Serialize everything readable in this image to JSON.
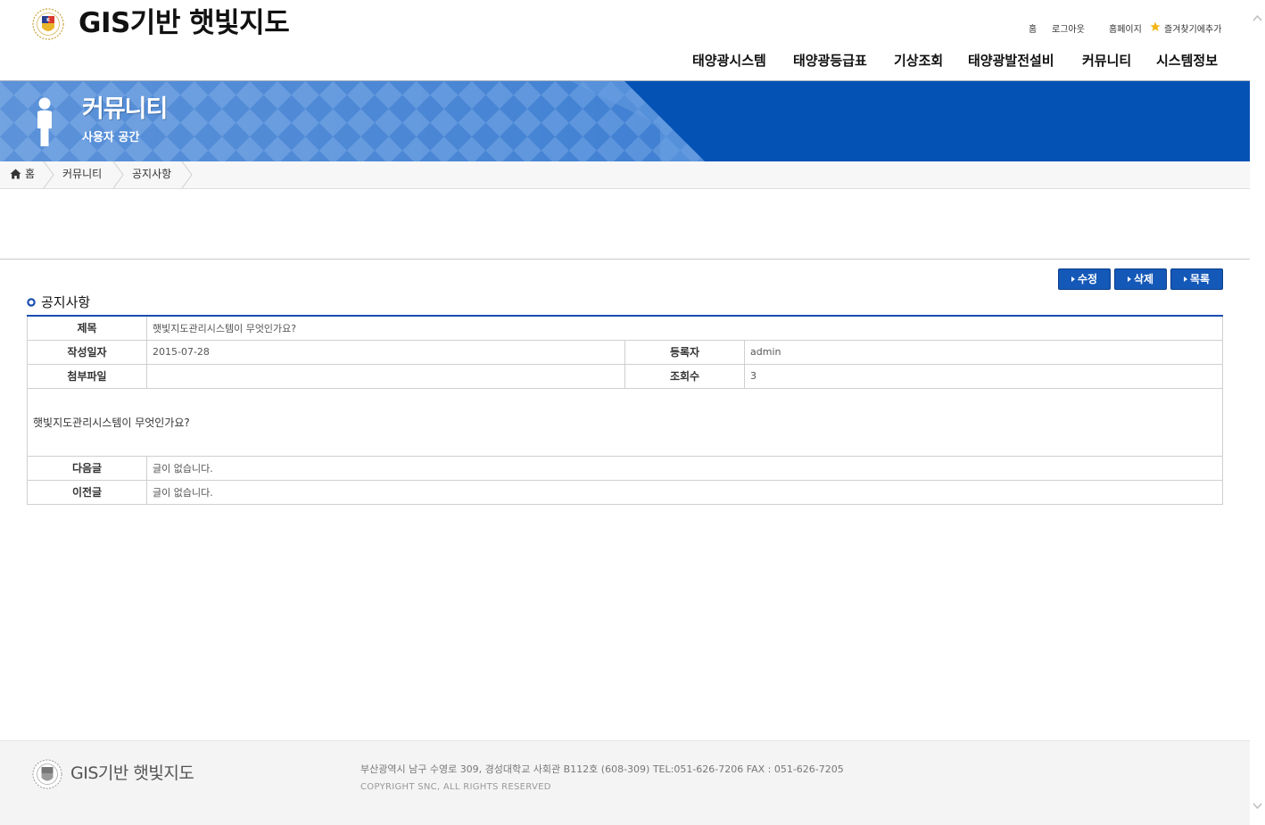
{
  "header": {
    "site_title": "GIS기반 햇빛지도",
    "util_links": [
      "홈",
      "로그아웃",
      "홈페이지",
      "즐겨찾기에추가"
    ],
    "gnb": [
      "태양광시스템",
      "태양광등급표",
      "기상조회",
      "태양광발전설비",
      "커뮤니티",
      "시스템정보"
    ]
  },
  "banner": {
    "title": "커뮤니티",
    "subtitle": "사용자 공간",
    "icon": "person-icon"
  },
  "breadcrumb": [
    "홈",
    "커뮤니티",
    "공지사항"
  ],
  "actions": {
    "edit": "수정",
    "delete": "삭제",
    "list": "목록"
  },
  "section_title": "공지사항",
  "post": {
    "subject_label": "제목",
    "subject": "햇빛지도관리시스템이 무엇인가요?",
    "date_label": "작성일자",
    "date": "2015-07-28",
    "author_label": "등록자",
    "author": "admin",
    "attach_label": "첨부파일",
    "attach": "",
    "views_label": "조회수",
    "views": "3",
    "body": "햇빛지도관리시스템이 무엇인가요?",
    "next_label": "다음글",
    "next": "글이 없습니다.",
    "prev_label": "이전글",
    "prev": "글이 없습니다."
  },
  "footer": {
    "title": "GIS기반 햇빛지도",
    "address": "부산광역시 남구 수영로 309, 경성대학교 사회관 B112호 (608-309) TEL:051-626-7206 FAX : 051-626-7205",
    "copyright": "COPYRIGHT SNC, ALL RIGHTS RESERVED"
  },
  "colors": {
    "brand_blue": "#0452b4",
    "button_blue": "#1458b8",
    "table_top_border": "#1a4eb0"
  }
}
